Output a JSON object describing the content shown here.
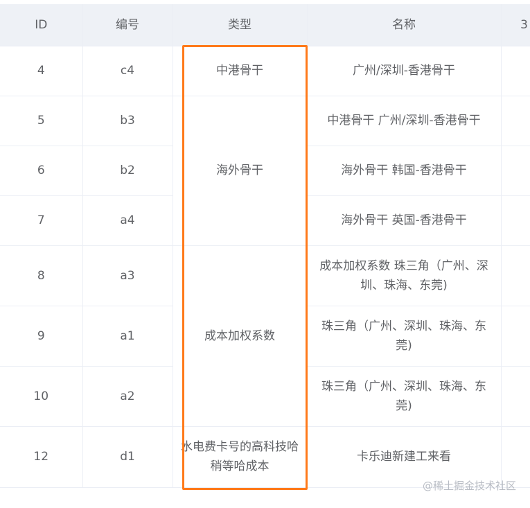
{
  "table": {
    "headers": [
      "ID",
      "编号",
      "类型",
      "名称",
      "3"
    ],
    "rows": [
      {
        "id": "4",
        "code": "c4",
        "name": "广州/深圳-香港骨干"
      },
      {
        "id": "5",
        "code": "b3",
        "name": "中港骨干 广州/深圳-香港骨干"
      },
      {
        "id": "6",
        "code": "b2",
        "name": "海外骨干 韩国-香港骨干"
      },
      {
        "id": "7",
        "code": "a4",
        "name": "海外骨干 英国-香港骨干"
      },
      {
        "id": "8",
        "code": "a3",
        "name": "成本加权系数 珠三角（广州、深圳、珠海、东莞)"
      },
      {
        "id": "9",
        "code": "a1",
        "name": "珠三角（广州、深圳、珠海、东莞)"
      },
      {
        "id": "10",
        "code": "a2",
        "name": "珠三角（广州、深圳、珠海、东莞)"
      },
      {
        "id": "12",
        "code": "d1",
        "name": "卡乐迪新建工来看"
      }
    ],
    "type_groups": [
      "中港骨干",
      "海外骨干",
      "成本加权系数",
      "水电费卡号的高科技哈稍等哈成本"
    ]
  },
  "watermark": "@稀土掘金技术社区",
  "colors": {
    "highlight": "#ff7a1a",
    "header_bg": "#eef1f6",
    "border": "#ebeef5"
  }
}
